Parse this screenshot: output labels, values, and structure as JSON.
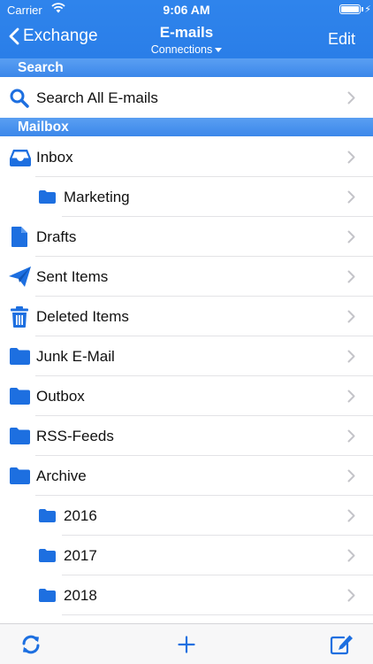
{
  "status": {
    "carrier": "Carrier",
    "time": "9:06 AM"
  },
  "nav": {
    "back_label": "Exchange",
    "title": "E-mails",
    "subtitle": "Connections",
    "edit_label": "Edit"
  },
  "sections": {
    "search": "Search",
    "mailbox": "Mailbox"
  },
  "search_row": {
    "label": "Search All E-mails",
    "icon": "search-icon"
  },
  "mailbox": [
    {
      "label": "Inbox",
      "icon": "inbox-icon"
    },
    {
      "label": "Marketing",
      "icon": "folder-icon"
    },
    {
      "label": "Drafts",
      "icon": "document-icon"
    },
    {
      "label": "Sent Items",
      "icon": "paper-plane-icon"
    },
    {
      "label": "Deleted Items",
      "icon": "trash-icon"
    },
    {
      "label": "Junk E-Mail",
      "icon": "folder-icon"
    },
    {
      "label": "Outbox",
      "icon": "folder-icon"
    },
    {
      "label": "RSS-Feeds",
      "icon": "folder-icon"
    },
    {
      "label": "Archive",
      "icon": "folder-icon"
    },
    {
      "label": "2016",
      "icon": "folder-icon"
    },
    {
      "label": "2017",
      "icon": "folder-icon"
    },
    {
      "label": "2018",
      "icon": "folder-icon"
    }
  ],
  "toolbar": {
    "refresh_icon": "refresh-icon",
    "add_icon": "plus-icon",
    "compose_icon": "compose-icon"
  },
  "colors": {
    "accent": "#1d6fe0",
    "header": "#2a7ee8",
    "section": "#4a94ef"
  }
}
